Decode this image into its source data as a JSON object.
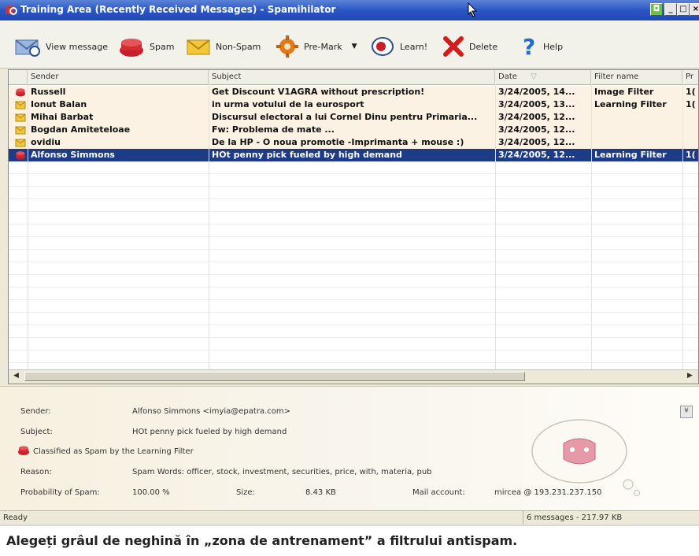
{
  "window": {
    "title": "Training Area (Recently Received Messages) - Spamihilator",
    "controls": [
      "help-icon",
      "minimize-icon",
      "maximize-icon",
      "close-icon"
    ]
  },
  "toolbar": {
    "view_message": "View message",
    "spam": "Spam",
    "non_spam": "Non-Spam",
    "pre_mark": "Pre-Mark",
    "learn": "Learn!",
    "delete": "Delete",
    "help": "Help"
  },
  "grid": {
    "columns": [
      "Sender",
      "Subject",
      "Date",
      "Filter name",
      "Pr"
    ],
    "rows": [
      {
        "type": "spam",
        "sender": "Russell",
        "subject": "Get Discount V1AGRA without prescription!",
        "date": "3/24/2005, 14...",
        "filter": "Image Filter",
        "pr": "1("
      },
      {
        "type": "ham",
        "sender": "Ionut Balan",
        "subject": "in urma votului de la eurosport",
        "date": "3/24/2005, 13...",
        "filter": "Learning Filter",
        "pr": "1("
      },
      {
        "type": "ham",
        "sender": "Mihai Barbat",
        "subject": "Discursul electoral a lui Cornel Dinu pentru Primaria...",
        "date": "3/24/2005, 12...",
        "filter": "",
        "pr": ""
      },
      {
        "type": "ham",
        "sender": "Bogdan Amiteteloae",
        "subject": "Fw: Problema de mate ...",
        "date": "3/24/2005, 12...",
        "filter": "",
        "pr": ""
      },
      {
        "type": "ham",
        "sender": "ovidiu",
        "subject": "De la HP - O noua promotie -Imprimanta + mouse :)",
        "date": "3/24/2005, 12...",
        "filter": "",
        "pr": ""
      },
      {
        "type": "spam",
        "sender": "Alfonso Simmons",
        "subject": "HOt penny pick fueled by high demand",
        "date": "3/24/2005, 12...",
        "filter": "Learning Filter",
        "pr": "1("
      }
    ]
  },
  "details": {
    "sender_label": "Sender:",
    "sender_value": "Alfonso Simmons <imyia@epatra.com>",
    "subject_label": "Subject:",
    "subject_value": "HOt penny pick fueled by high demand",
    "classified": "Classified as Spam by the Learning Filter",
    "reason_label": "Reason:",
    "reason_value": "Spam Words: officer, stock, investment, securities, price, with, materia, pub",
    "prob_label": "Probability of Spam:",
    "prob_value": "100.00 %",
    "size_label": "Size:",
    "size_value": "8.43 KB",
    "account_label": "Mail account:",
    "account_value": "mircea @ 193.231.237.150"
  },
  "status": {
    "left": "Ready",
    "right": "6 messages - 217.97 KB"
  },
  "caption": "Alegeți grâul de neghină în „zona de antrenament” a filtrului antispam."
}
